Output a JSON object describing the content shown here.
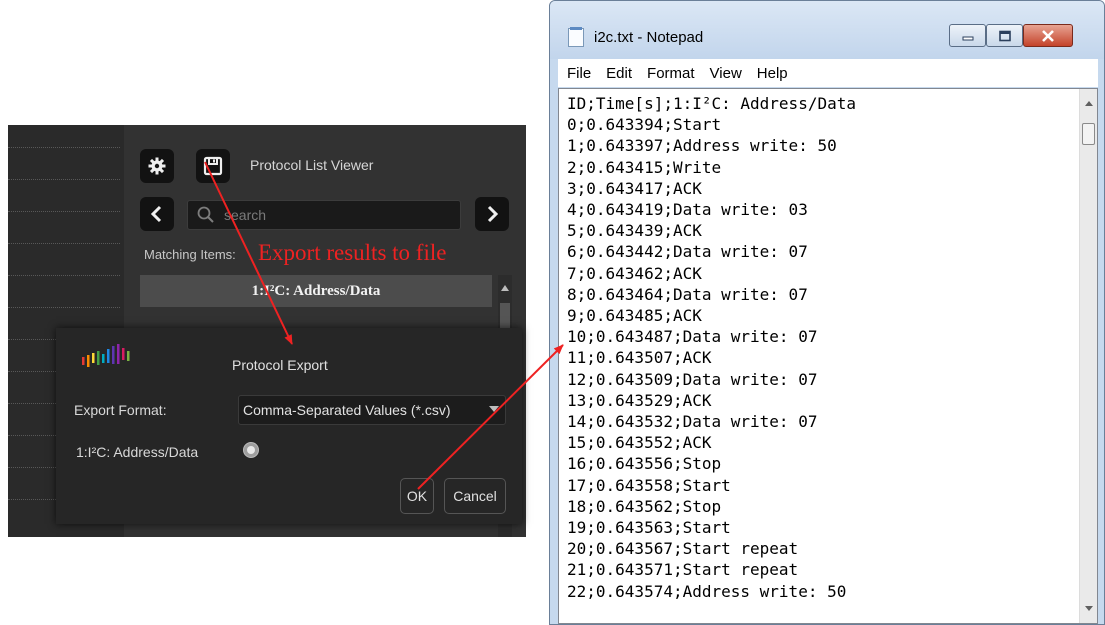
{
  "protocol_list_viewer": {
    "title": "Protocol List Viewer",
    "settings_icon": "gear-icon",
    "export_icon": "floppy-disk-icon",
    "prev_icon": "chevron-left-icon",
    "next_icon": "chevron-right-icon",
    "search_icon": "search-icon",
    "search_placeholder": "search",
    "matching_items_label": "Matching Items:",
    "column_header": "1:I²C: Address/Data"
  },
  "export_dialog": {
    "logo_icon": "color-bars-logo",
    "title": "Protocol Export",
    "format_label": "Export Format:",
    "format_value": "Comma-Separated Values (*.csv)",
    "channel_label": "1:I²C: Address/Data",
    "channel_selected": true,
    "ok_label": "OK",
    "cancel_label": "Cancel"
  },
  "notepad": {
    "title": "i2c.txt - Notepad",
    "menu": [
      "File",
      "Edit",
      "Format",
      "View",
      "Help"
    ],
    "lines": [
      "ID;Time[s];1:I²C: Address/Data",
      "0;0.643394;Start",
      "1;0.643397;Address write: 50",
      "2;0.643415;Write",
      "3;0.643417;ACK",
      "4;0.643419;Data write: 03",
      "5;0.643439;ACK",
      "6;0.643442;Data write: 07",
      "7;0.643462;ACK",
      "8;0.643464;Data write: 07",
      "9;0.643485;ACK",
      "10;0.643487;Data write: 07",
      "11;0.643507;ACK",
      "12;0.643509;Data write: 07",
      "13;0.643529;ACK",
      "14;0.643532;Data write: 07",
      "15;0.643552;ACK",
      "16;0.643556;Stop",
      "17;0.643558;Start",
      "18;0.643562;Stop",
      "19;0.643563;Start",
      "20;0.643567;Start repeat",
      "21;0.643571;Start repeat",
      "22;0.643574;Address write: 50"
    ]
  },
  "annotation": {
    "label": "Export results to file",
    "color": "#ee2222"
  }
}
